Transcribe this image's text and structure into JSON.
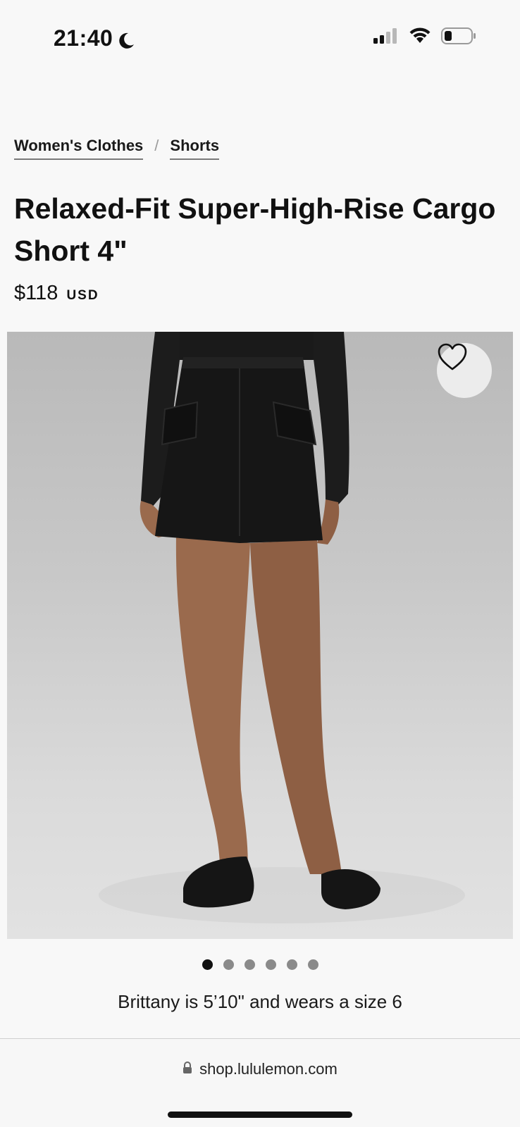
{
  "status_bar": {
    "time": "21:40",
    "icons": [
      "moon-icon",
      "signal-icon",
      "wifi-icon",
      "battery-icon"
    ]
  },
  "breadcrumb": {
    "items": [
      "Women's Clothes",
      "Shorts"
    ],
    "separator": "/"
  },
  "product": {
    "title": "Relaxed-Fit Super-High-Rise Cargo Short 4\"",
    "price": "$118",
    "currency": "USD",
    "wishlist_icon": "heart-icon",
    "model_info": "Brittany is 5’10\" and wears a size 6"
  },
  "carousel": {
    "total_images": 6,
    "active_index": 0
  },
  "browser": {
    "url": "shop.lululemon.com",
    "lock_icon": "lock-icon"
  },
  "colors": {
    "background": "#f8f8f8",
    "text": "#111111",
    "dot_inactive": "#8a8a8a",
    "dot_active": "#111111"
  }
}
